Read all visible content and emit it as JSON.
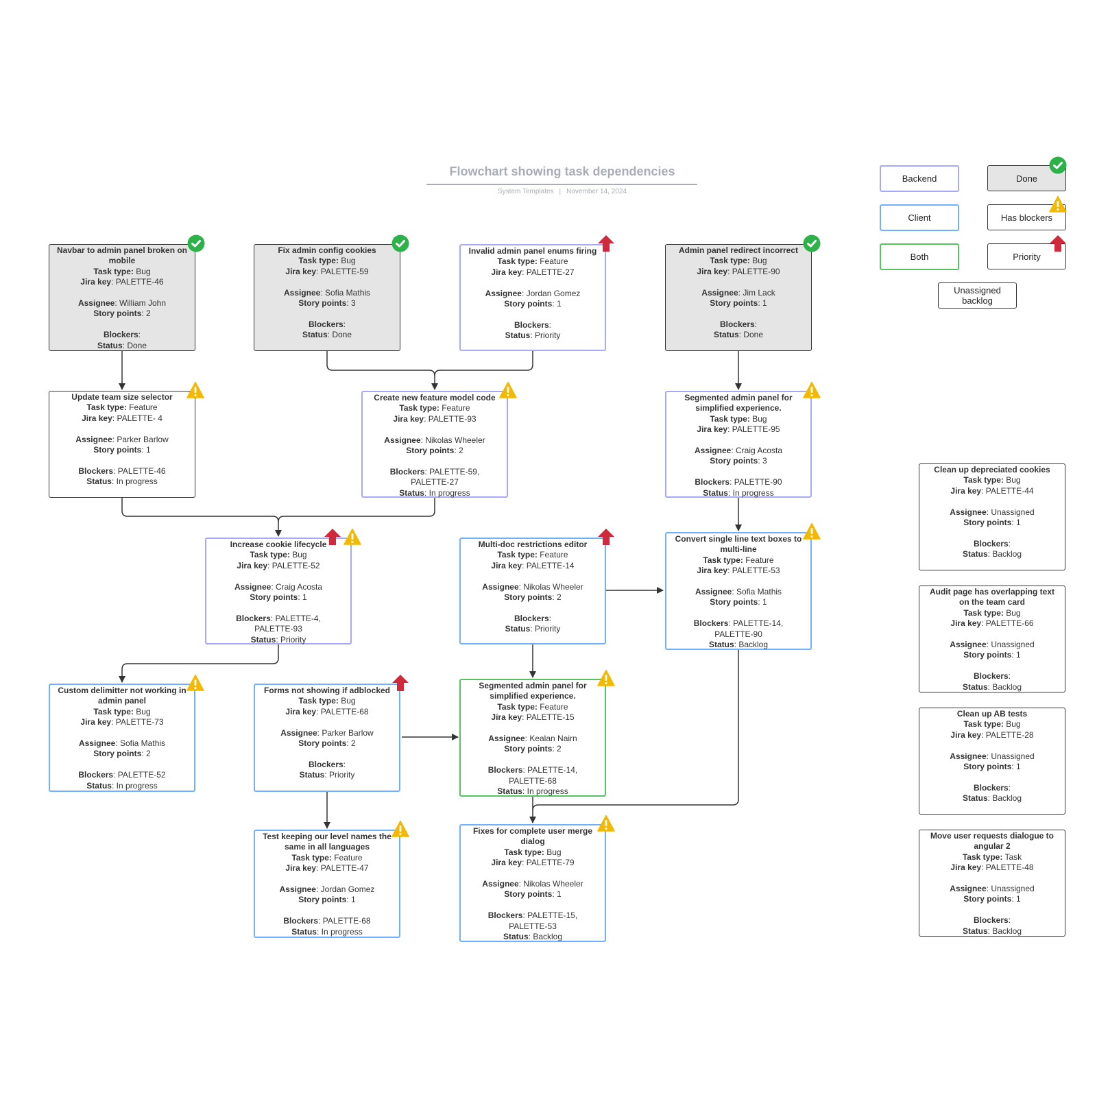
{
  "header": {
    "title": "Flowchart showing task dependencies",
    "source": "System Templates",
    "separator": "|",
    "date": "November 14, 2024"
  },
  "legend": {
    "backend": "Backend",
    "client": "Client",
    "both": "Both",
    "done": "Done",
    "has_blockers": "Has blockers",
    "priority": "Priority",
    "unassigned_line1": "Unassigned",
    "unassigned_line2": "backlog"
  },
  "labels": {
    "task_type": "Task type:",
    "jira_key": "Jira key",
    "assignee": "Assignee",
    "story_points": "Story points",
    "blockers": "Blockers",
    "status": "Status",
    "colon": ":"
  },
  "colors": {
    "backend": "#a8a8f8",
    "client": "#6fb1ff",
    "both": "#55c35f",
    "done_fill": "#e5e5e5",
    "done_icon": "#2db24a",
    "blocker_icon": "#f5b800",
    "priority_icon": "#d0293b",
    "title": "#a8adb8"
  },
  "tasks": {
    "navbar": {
      "title1": "Navbar to admin panel broken on",
      "title2": "mobile",
      "type": "Bug",
      "key": "PALETTE-46",
      "assignee": "William John",
      "points": "2",
      "blockers": "",
      "status": "Done"
    },
    "fixcookies": {
      "title1": "Fix admin config cookies",
      "type": "Bug",
      "key": "PALETTE-59",
      "assignee": "Sofia Mathis",
      "points": "3",
      "blockers": "",
      "status": "Done"
    },
    "enums": {
      "title1": "Invalid admin panel enums firing",
      "type": "Feature",
      "key": "PALETTE-27",
      "assignee": "Jordan Gomez",
      "points": "1",
      "blockers": "",
      "status": "Priority"
    },
    "redirect": {
      "title1": "Admin panel redirect incorrect",
      "type": "Bug",
      "key": "PALETTE-90",
      "assignee": "Jim Lack",
      "points": "1",
      "blockers": "",
      "status": "Done"
    },
    "teamsize": {
      "title1": "Update team size selector",
      "type": "Feature",
      "key": "PALETTE- 4",
      "assignee": "Parker Barlow",
      "points": "1",
      "blockers": "PALETTE-46",
      "status": "In progress"
    },
    "featuremodel": {
      "title1": "Create new feature model code",
      "type": "Feature",
      "key": "PALETTE-93",
      "assignee": "Nikolas Wheeler",
      "points": "2",
      "blockers": "PALETTE-59,",
      "blockers2": "PALETTE-27",
      "status": "In progress"
    },
    "segmented95": {
      "title1": "Segmented admin panel for",
      "title2": "simplified experience.",
      "type": "Bug",
      "key": "PALETTE-95",
      "assignee": "Craig Acosta",
      "points": "3",
      "blockers": "PALETTE-90",
      "status": "In progress"
    },
    "cookielife": {
      "title1": "Increase cookie lifecycle",
      "type": "Bug",
      "key": "PALETTE-52",
      "assignee": "Craig Acosta",
      "points": "1",
      "blockers": "PALETTE-4,",
      "blockers2": "PALETTE-93",
      "status": "Priority"
    },
    "multidoc": {
      "title1": "Multi-doc restrictions editor",
      "type": "Feature",
      "key": "PALETTE-14",
      "assignee": "Nikolas Wheeler",
      "points": "2",
      "blockers": "",
      "status": "Priority"
    },
    "multiline": {
      "title1": "Convert single line text boxes to",
      "title2": "multi-line",
      "type": "Feature",
      "key": "PALETTE-53",
      "assignee": "Sofia Mathis",
      "points": "1",
      "blockers": "PALETTE-14,",
      "blockers2": "PALETTE-90",
      "status": "Backlog"
    },
    "delimiter": {
      "title1": "Custom delimitter not working in",
      "title2": "admin panel",
      "type": "Bug",
      "key": "PALETTE-73",
      "assignee": "Sofia Mathis",
      "points": "2",
      "blockers": "PALETTE-52",
      "status": "In progress"
    },
    "adblock": {
      "title1": "Forms not showing if adblocked",
      "type": "Bug",
      "key": "PALETTE-68",
      "assignee": "Parker Barlow",
      "points": "2",
      "blockers": "",
      "status": "Priority"
    },
    "segmented15": {
      "title1": "Segmented admin panel for",
      "title2": "simplified experience.",
      "type": "Feature",
      "key": "PALETTE-15",
      "assignee": "Kealan Nairn",
      "points": "2",
      "blockers": "PALETTE-14,",
      "blockers2": "PALETTE-68",
      "status": "In progress"
    },
    "levelnames": {
      "title1": "Test keeping our level names the",
      "title2": "same in all languages",
      "type": "Feature",
      "key": "PALETTE-47",
      "assignee": "Jordan Gomez",
      "points": "1",
      "blockers": "PALETTE-68",
      "status": "In progress"
    },
    "usermerge": {
      "title1": "Fixes for complete user merge",
      "title2": "dialog",
      "type": "Bug",
      "key": "PALETTE-79",
      "assignee": "Nikolas Wheeler",
      "points": "1",
      "blockers": "PALETTE-15,",
      "blockers2": "PALETTE-53",
      "status": "Backlog"
    },
    "depcookies": {
      "title1": "Clean up depreciated cookies",
      "type": "Bug",
      "key": "PALETTE-44",
      "assignee": "Unassigned",
      "points": "1",
      "blockers": "",
      "status": "Backlog"
    },
    "auditpage": {
      "title1": "Audit page has overlapping text",
      "title2": "on the team card",
      "type": "Bug",
      "key": "PALETTE-66",
      "assignee": "Unassigned",
      "points": "1",
      "blockers": "",
      "status": "Backlog"
    },
    "abtests": {
      "title1": "Clean up AB tests",
      "type": "Bug",
      "key": "PALETTE-28",
      "assignee": "Unassigned",
      "points": "1",
      "blockers": "",
      "status": "Backlog"
    },
    "angular": {
      "title1": "Move user requests dialogue to",
      "title2": "angular 2",
      "type": "Task",
      "key": "PALETTE-48",
      "assignee": "Unassigned",
      "points": "1",
      "blockers": "",
      "status": "Backlog"
    }
  }
}
